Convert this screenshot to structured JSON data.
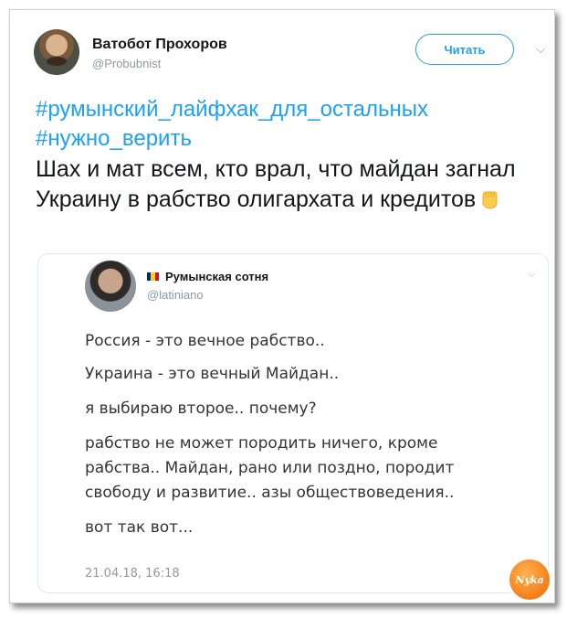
{
  "tweet": {
    "author_name": "Ватобот Прохоров",
    "author_handle": "@Probubnist",
    "follow_label": "Читать",
    "hashtags": [
      "#румынский_лайфхак_для_остальных",
      "#нужно_верить"
    ],
    "text": "Шах и мат всем, кто врал, что майдан загнал Украину в рабство олигархата и кредитов",
    "emoji_icon": "raised-fist-icon"
  },
  "quoted": {
    "author_name": "Румынская сотня",
    "author_handle": "@latiniano",
    "flag_colors": [
      "#002b7f",
      "#fcd116",
      "#ce1126"
    ],
    "paragraphs": [
      "Россия - это вечное рабство..",
      "Украина - это вечный Майдан..",
      "я выбираю второе.. почему?",
      "рабство не может породить ничего, кроме рабства.. Майдан, рано или поздно, породит свободу и развитие.. азы обществоведения..",
      "вот так вот..."
    ],
    "date": "21.04.18, 16:18"
  },
  "watermark": {
    "text": "Nyka"
  },
  "colors": {
    "accent": "#1da1f2",
    "text": "#14171a",
    "muted": "#8f9aa3"
  }
}
